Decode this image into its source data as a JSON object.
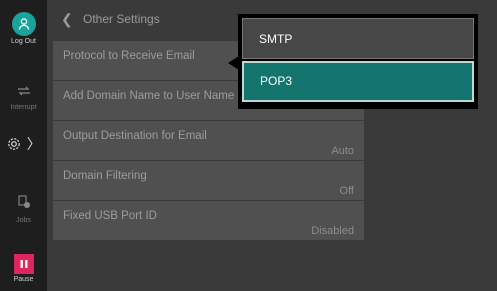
{
  "rail": {
    "logout_label": "Log Out",
    "interrupt_label": "Interrupt",
    "jobs_label": "Jobs",
    "pause_label": "Pause"
  },
  "header": {
    "title": "Other Settings"
  },
  "settings": [
    {
      "label": "Protocol to Receive Email",
      "value": ""
    },
    {
      "label": "Add Domain Name to User Name",
      "value": ""
    },
    {
      "label": "Output Destination for Email",
      "value": "Auto"
    },
    {
      "label": "Domain Filtering",
      "value": "Off"
    },
    {
      "label": "Fixed USB Port ID",
      "value": "Disabled"
    }
  ],
  "popup": {
    "options": [
      "SMTP",
      "POP3"
    ],
    "selected": "POP3"
  },
  "icons": {
    "logout": "person-icon",
    "interrupt": "interrupt-arrows-icon",
    "settings": "gear-icon",
    "jobs": "jobs-icon",
    "pause": "pause-icon",
    "back": "chevron-left-icon"
  },
  "colors": {
    "accent": "#1aa39a",
    "selected_option": "#14756e",
    "pause": "#e0245e"
  }
}
